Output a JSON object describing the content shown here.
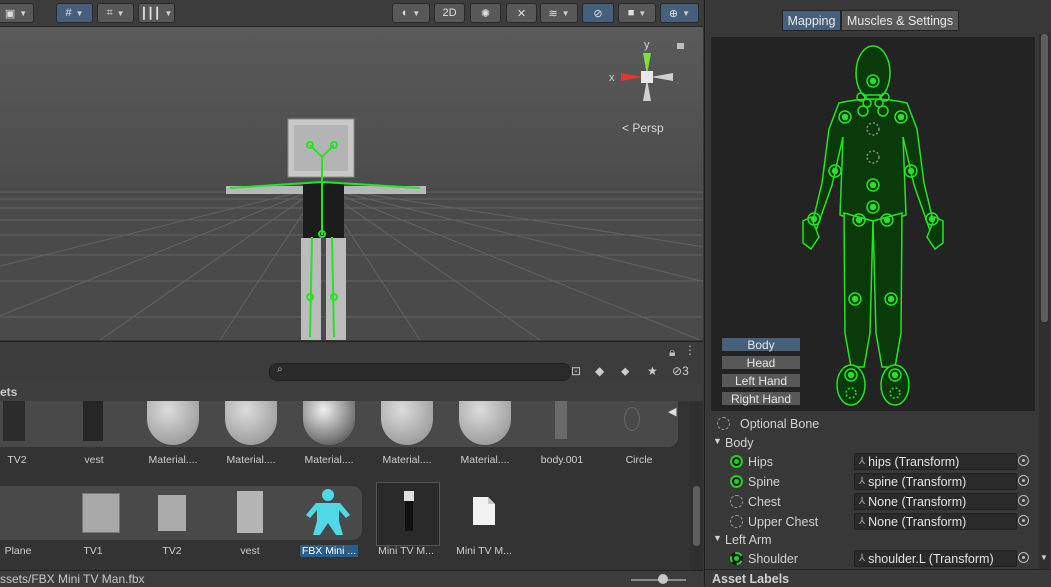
{
  "scene_toolbar": {
    "shading_mode": "",
    "mode_2d": "2D"
  },
  "scene_view": {
    "projection_label": "Persp",
    "gizmo_axis_x": "x",
    "gizmo_axis_y": "y"
  },
  "project_browser": {
    "assets_header": "ets",
    "hidden_count": "3",
    "row1": [
      {
        "label": "TV2"
      },
      {
        "label": "vest"
      },
      {
        "label": "Material...."
      },
      {
        "label": "Material...."
      },
      {
        "label": "Material...."
      },
      {
        "label": "Material...."
      },
      {
        "label": "Material...."
      },
      {
        "label": "body.001"
      },
      {
        "label": "Circle"
      }
    ],
    "row2": [
      {
        "label": "Plane"
      },
      {
        "label": "TV1"
      },
      {
        "label": "TV2"
      },
      {
        "label": "vest"
      },
      {
        "label": "FBX Mini ...",
        "selected": true
      },
      {
        "label": "Mini TV M..."
      },
      {
        "label": "Mini TV M..."
      }
    ],
    "status_path": "ssets/FBX Mini TV Man.fbx"
  },
  "inspector": {
    "tabs": [
      "Mapping",
      "Muscles & Settings"
    ],
    "active_tab": "Mapping",
    "body_parts": [
      "Body",
      "Head",
      "Left Hand",
      "Right Hand"
    ],
    "active_part": "Body",
    "legend_optional": "Optional Bone",
    "groups": [
      {
        "name": "Body",
        "bones": [
          {
            "label": "Hips",
            "value": "hips (Transform)",
            "required": true
          },
          {
            "label": "Spine",
            "value": "spine (Transform)",
            "required": true
          },
          {
            "label": "Chest",
            "value": "None (Transform)",
            "required": false
          },
          {
            "label": "Upper Chest",
            "value": "None (Transform)",
            "required": false
          }
        ]
      },
      {
        "name": "Left Arm",
        "bones": [
          {
            "label": "Shoulder",
            "value": "shoulder.L (Transform)",
            "required": true,
            "dashed_green": true
          }
        ]
      }
    ],
    "asset_labels": "Asset Labels"
  },
  "colors": {
    "accent_selected": "#46607c",
    "bone_green": "#1ed21e",
    "selection_blue": "#2c5d87"
  }
}
